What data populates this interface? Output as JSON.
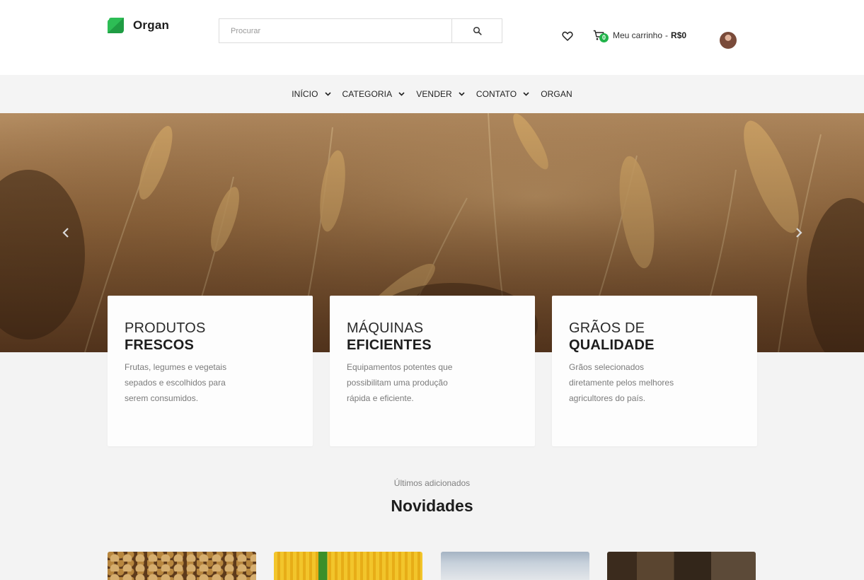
{
  "header": {
    "brand": "Organ",
    "search": {
      "placeholder": "Procurar",
      "value": ""
    },
    "cart": {
      "count": "0",
      "label": "Meu carrinho",
      "separator": "-",
      "total": "R$0"
    },
    "icons": {
      "logo": "leaf-logo-icon",
      "search": "search-icon",
      "wishlist": "heart-icon",
      "cart": "cart-icon",
      "user": "avatar"
    }
  },
  "nav": {
    "items": [
      {
        "label": "INÍCIO",
        "has_dropdown": true
      },
      {
        "label": "CATEGORIA",
        "has_dropdown": true
      },
      {
        "label": "VENDER",
        "has_dropdown": true
      },
      {
        "label": "CONTATO",
        "has_dropdown": true
      },
      {
        "label": "ORGAN",
        "has_dropdown": false
      }
    ]
  },
  "hero": {
    "image": "wheat-field",
    "prev_icon": "chevron-left-icon",
    "next_icon": "chevron-right-icon"
  },
  "features": [
    {
      "title_light": "PRODUTOS",
      "title_bold": "FRESCOS",
      "description": "Frutas, legumes e vegetais sepados e escolhidos para serem consumidos."
    },
    {
      "title_light": "MÁQUINAS",
      "title_bold": "EFICIENTES",
      "description": "Equipamentos potentes que possibilitam uma produção rápida e eficiente."
    },
    {
      "title_light": "GRÃOS DE",
      "title_bold": "QUALIDADE",
      "description": "Grãos selecionados diretamente pelos melhores agricultores do país."
    }
  ],
  "latest": {
    "subtitle": "Últimos adicionados",
    "title": "Novidades",
    "products": [
      {
        "image": "soybeans"
      },
      {
        "image": "corn"
      },
      {
        "image": "sky-field"
      },
      {
        "image": "barn-interior"
      }
    ]
  },
  "colors": {
    "accent": "#21b34a",
    "page_bg": "#f3f3f3",
    "card_bg": "#fdfdfd",
    "text_dark": "#1d1d1d",
    "text_muted": "#7b7b7b"
  }
}
